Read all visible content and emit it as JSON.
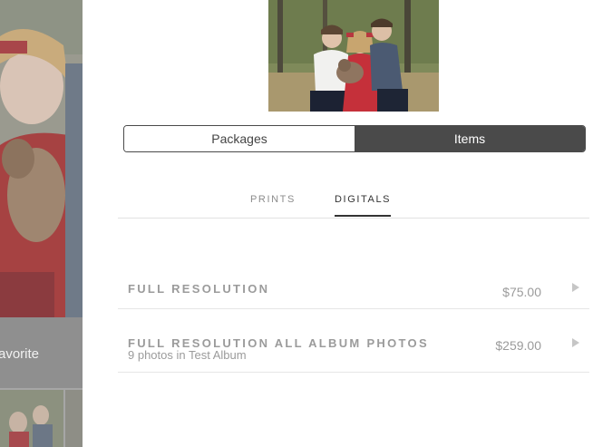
{
  "background": {
    "favorite_label": "avorite"
  },
  "toggle": {
    "packages_label": "Packages",
    "items_label": "Items",
    "active": "Items"
  },
  "tabs": [
    {
      "label": "PRINTS",
      "active": false
    },
    {
      "label": "DIGITALS",
      "active": true
    }
  ],
  "items": [
    {
      "name": "FULL RESOLUTION",
      "subtitle": "",
      "price": "$75.00"
    },
    {
      "name": "FULL RESOLUTION ALL ALBUM PHOTOS",
      "subtitle": "9 photos in Test Album",
      "price": "$259.00"
    }
  ],
  "colors": {
    "dark": "#4a4a4a",
    "muted_text": "#9b9b9b",
    "divider": "#e6e6e6"
  }
}
